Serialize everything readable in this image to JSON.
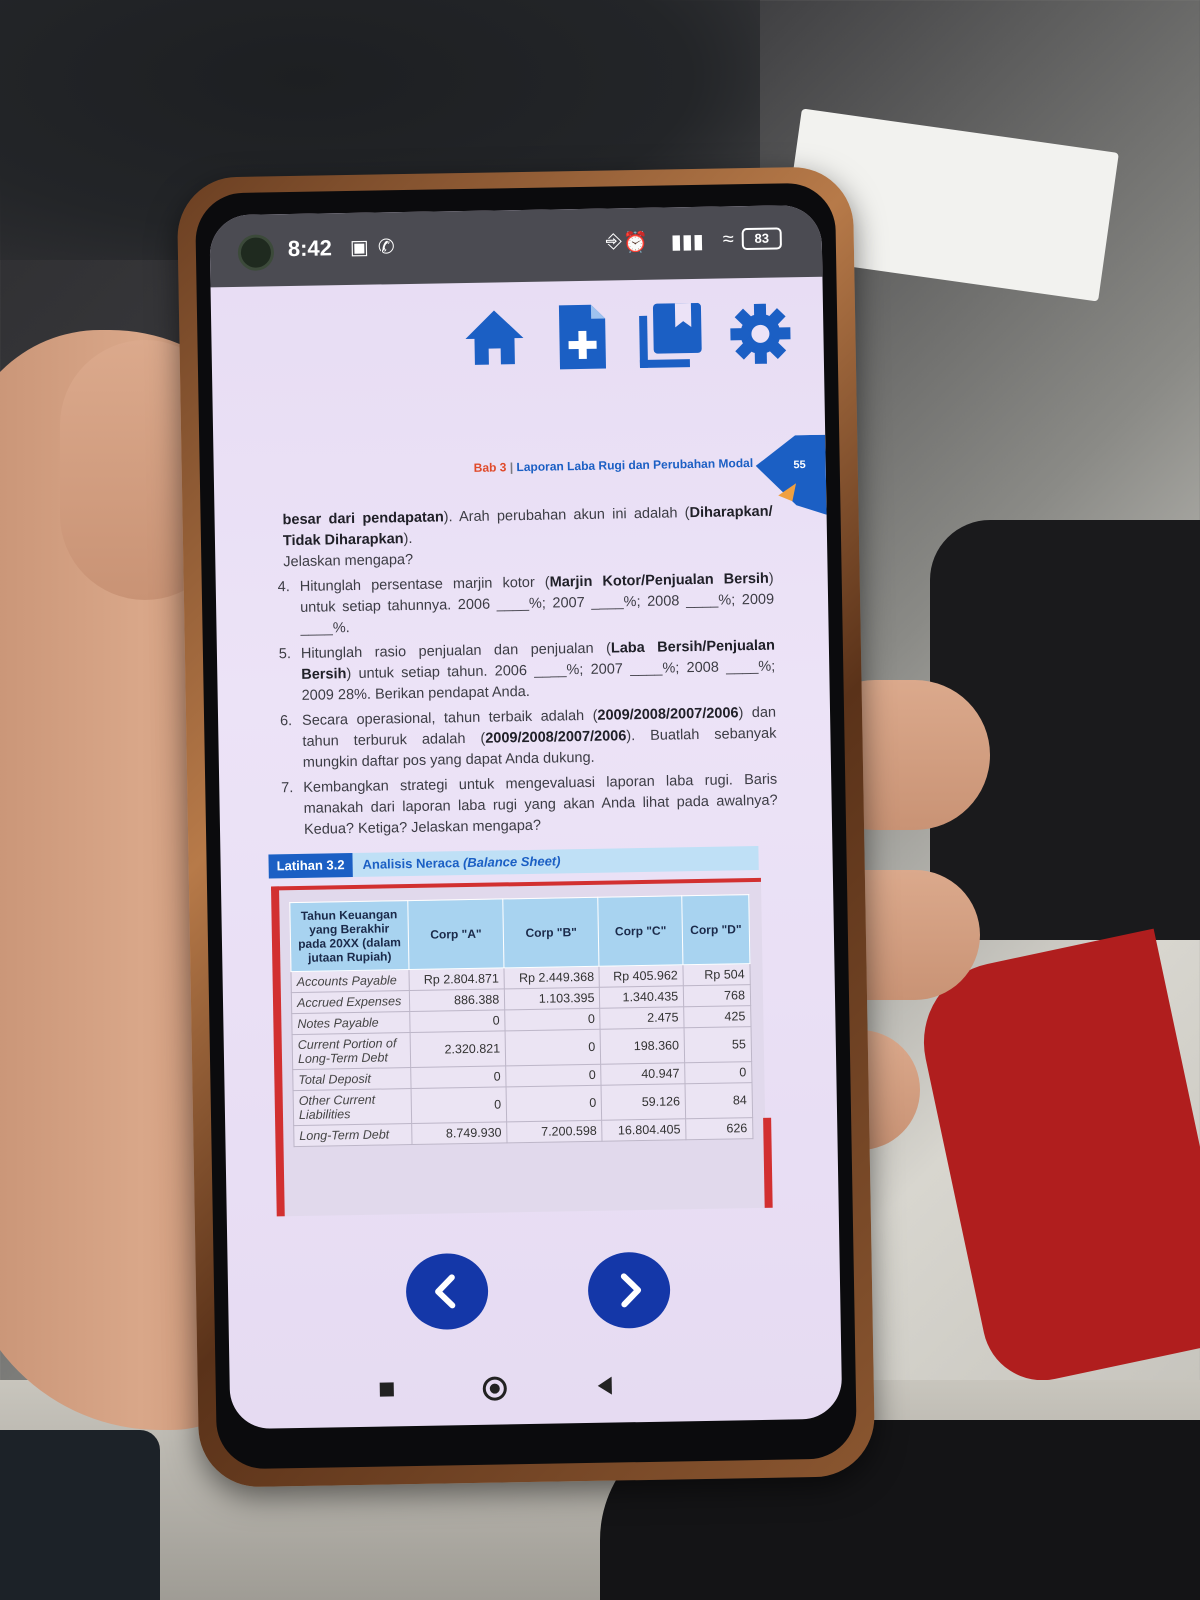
{
  "status": {
    "time": "8:42",
    "battery": "83"
  },
  "toolbar": {
    "home_icon": "home-icon",
    "add_page_icon": "add-document-icon",
    "bookmark_icon": "bookmarks-icon",
    "settings_icon": "gear-icon"
  },
  "page": {
    "chapter": "Bab 3",
    "separator": "|",
    "chapter_title": "Laporan Laba Rugi dan Perubahan Modal",
    "page_number": "55"
  },
  "content": {
    "intro_line1_bold": "besar dari pendapatan",
    "intro_line1_rest": "). Arah perubahan akun ini adalah (",
    "intro_bold2": "Diharapkan/ Tidak Diharapkan",
    "intro_end": ").",
    "intro_line3": "Jelaskan mengapa?",
    "q4_num": "4.",
    "q4_a": "Hitunglah persentase marjin kotor (",
    "q4_bold": "Marjin Kotor/Penjualan Bersih",
    "q4_b": ") untuk setiap tahunnya. 2006 ____%; 2007 ____%; 2008 ____%; 2009 ____%.",
    "q5_num": "5.",
    "q5_a": "Hitunglah rasio penjualan dan penjualan (",
    "q5_bold": "Laba Bersih/Penjualan Bersih",
    "q5_b": ") untuk setiap tahun. 2006 ____%; 2007 ____%; 2008 ____%; 2009 28%. Berikan pendapat Anda.",
    "q6_num": "6.",
    "q6_a": "Secara operasional, tahun terbaik adalah (",
    "q6_bold1": "2009/2008/2007/2006",
    "q6_b": ") dan tahun terburuk adalah (",
    "q6_bold2": "2009/2008/2007/2006",
    "q6_c": "). Buatlah sebanyak mungkin daftar pos yang dapat Anda dukung.",
    "q7_num": "7.",
    "q7": "Kembangkan strategi untuk mengevaluasi laporan laba rugi. Baris manakah dari laporan laba rugi yang akan Anda lihat pada awalnya? Kedua? Ketiga? Jelaskan mengapa?"
  },
  "latihan": {
    "tag": "Latihan 3.2",
    "name": "Analisis Neraca ",
    "name_italic": "(Balance Sheet)"
  },
  "table": {
    "header_col0": "Tahun Keuangan yang Berakhir pada 20XX (dalam jutaan Rupiah)",
    "headers": [
      "Corp \"A\"",
      "Corp \"B\"",
      "Corp \"C\"",
      "Corp \"D\""
    ],
    "rows": [
      {
        "label": "Accounts Payable",
        "a": "Rp 2.804.871",
        "b": "Rp 2.449.368",
        "c": "Rp 405.962",
        "d": "Rp 504"
      },
      {
        "label": "Accrued Expenses",
        "a": "886.388",
        "b": "1.103.395",
        "c": "1.340.435",
        "d": "768"
      },
      {
        "label": "Notes Payable",
        "a": "0",
        "b": "0",
        "c": "2.475",
        "d": "425"
      },
      {
        "label": "Current Portion of Long-Term Debt",
        "a": "2.320.821",
        "b": "0",
        "c": "198.360",
        "d": "55"
      },
      {
        "label": "Total Deposit",
        "a": "0",
        "b": "0",
        "c": "40.947",
        "d": "0"
      },
      {
        "label": "Other Current Liabilities",
        "a": "0",
        "b": "0",
        "c": "59.126",
        "d": "84"
      },
      {
        "label": "Long-Term Debt",
        "a": "8.749.930",
        "b": "7.200.598",
        "c": "16.804.405",
        "d": "626"
      }
    ]
  },
  "nav": {
    "prev_icon": "chevron-left-icon",
    "next_icon": "chevron-right-icon"
  },
  "colors": {
    "accent_blue": "#1b5fc4",
    "nav_button": "#1437a8",
    "accent_red": "#d23030"
  }
}
